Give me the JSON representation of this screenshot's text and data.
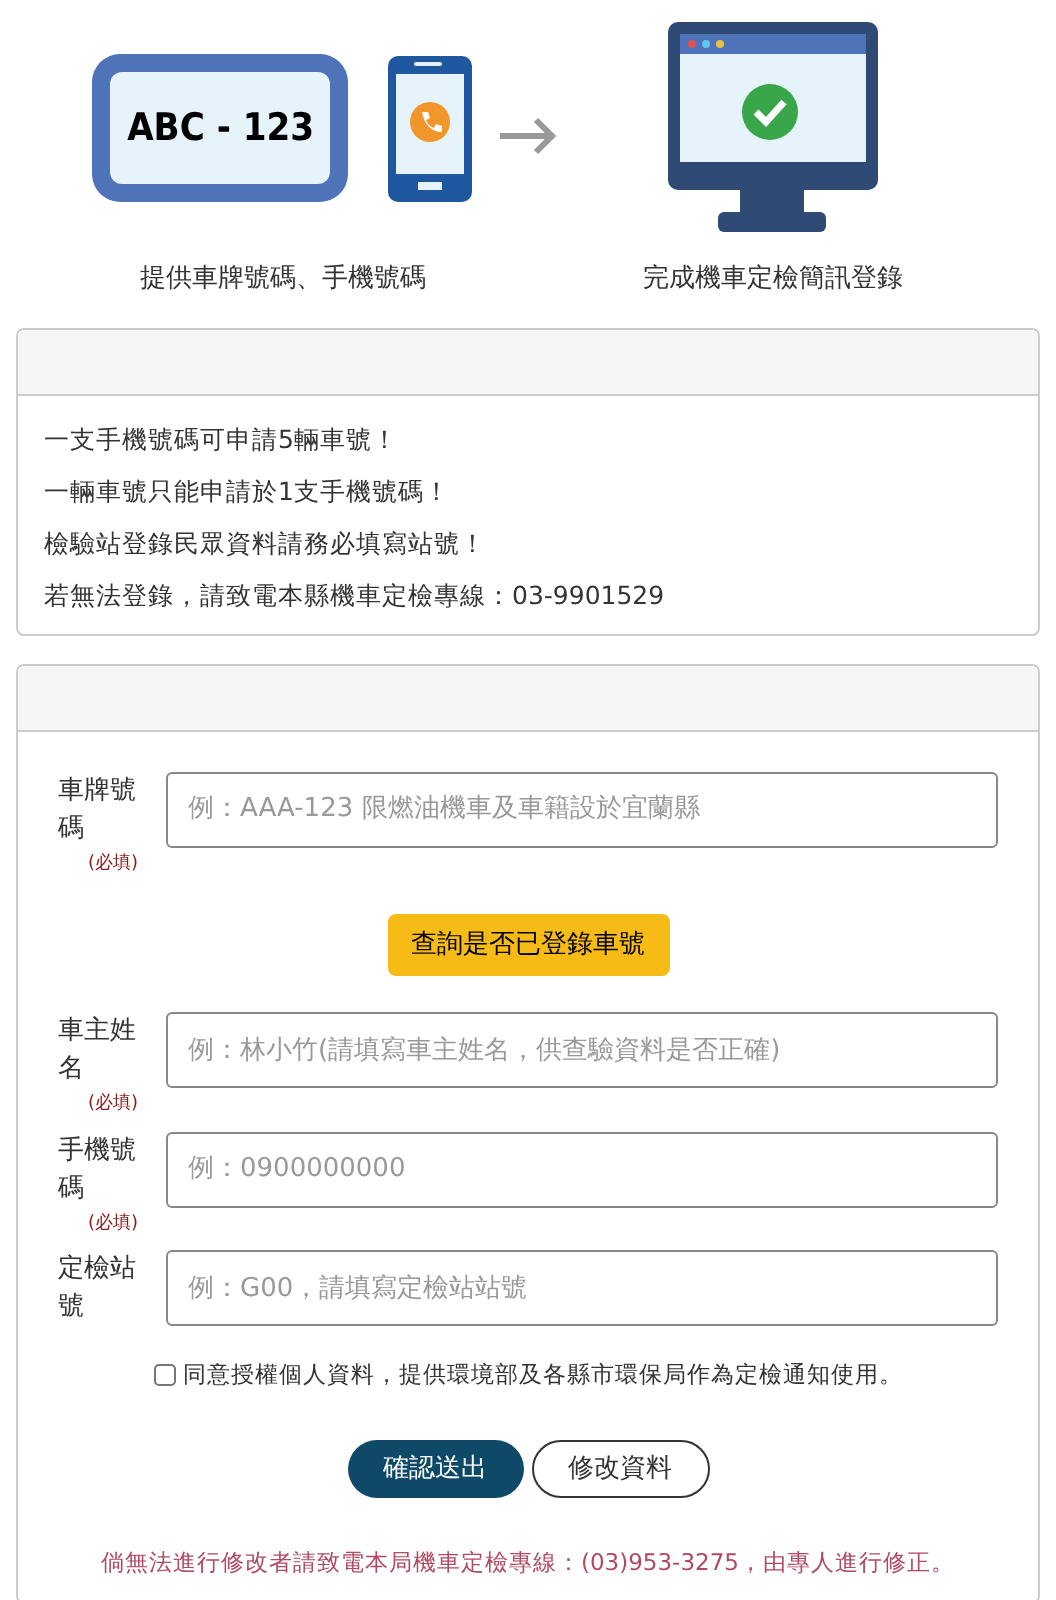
{
  "steps": [
    {
      "kind": "plate",
      "plate_text": "ABC - 123",
      "caption": "提供車牌號碼、手機號碼"
    },
    {
      "kind": "monitor",
      "caption": "完成機車定檢簡訊登錄"
    }
  ],
  "notice": {
    "lines": [
      "一支手機號碼可申請5輛車號！",
      "一輛車號只能申請於1支手機號碼！",
      "檢驗站登錄民眾資料請務必填寫站號！",
      "若無法登錄，請致電本縣機車定檢專線：03-9901529"
    ]
  },
  "form": {
    "fields": [
      {
        "label": "車牌號碼",
        "required_text": "(必填)",
        "placeholder": "例：AAA-123 限燃油機車及車籍設於宜蘭縣"
      },
      {
        "kind": "button",
        "label": "查詢是否已登錄車號"
      },
      {
        "label": "車主姓名",
        "required_text": "(必填)",
        "placeholder": "例：林小竹(請填寫車主姓名，供查驗資料是否正確)"
      },
      {
        "label": "手機號碼",
        "required_text": "(必填)",
        "placeholder": "例：0900000000"
      },
      {
        "label": "定檢站號",
        "placeholder": "例：G00，請填寫定檢站站號"
      }
    ],
    "consent": {
      "label": "同意授權個人資料，提供環境部及各縣市環保局作為定檢通知使用。",
      "checked": false
    },
    "buttons": [
      {
        "kind": "primary",
        "label": "確認送出"
      },
      {
        "kind": "outline",
        "label": "修改資料"
      }
    ],
    "footnote": "倘無法進行修改者請致電本局機車定檢專線：(03)953-3275，由專人進行修正。"
  }
}
